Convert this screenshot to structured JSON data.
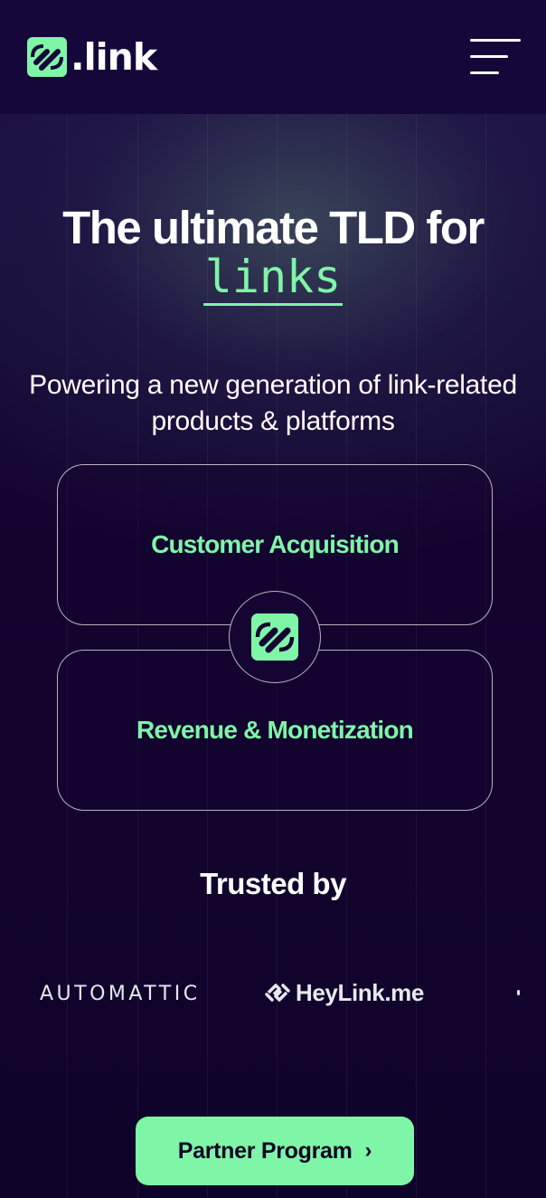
{
  "header": {
    "logo_text": ".link",
    "menu_icon": "hamburger-menu-icon"
  },
  "hero": {
    "title": "The ultimate TLD for",
    "accent": "links",
    "subtitle": "Powering a new generation of link-related products & platforms"
  },
  "cards": {
    "card1": "Customer Acquisition",
    "card2": "Revenue & Monetization",
    "connector_icon": "chain-link-icon"
  },
  "trusted": {
    "label": "Trusted by",
    "logos": [
      "AUTOMATTIC",
      "HeyLink.me"
    ]
  },
  "cta": {
    "label": "Partner Program",
    "chevron": "›"
  },
  "colors": {
    "accent": "#7ff5a8",
    "background": "#13042e",
    "header_bg": "#15073a"
  }
}
